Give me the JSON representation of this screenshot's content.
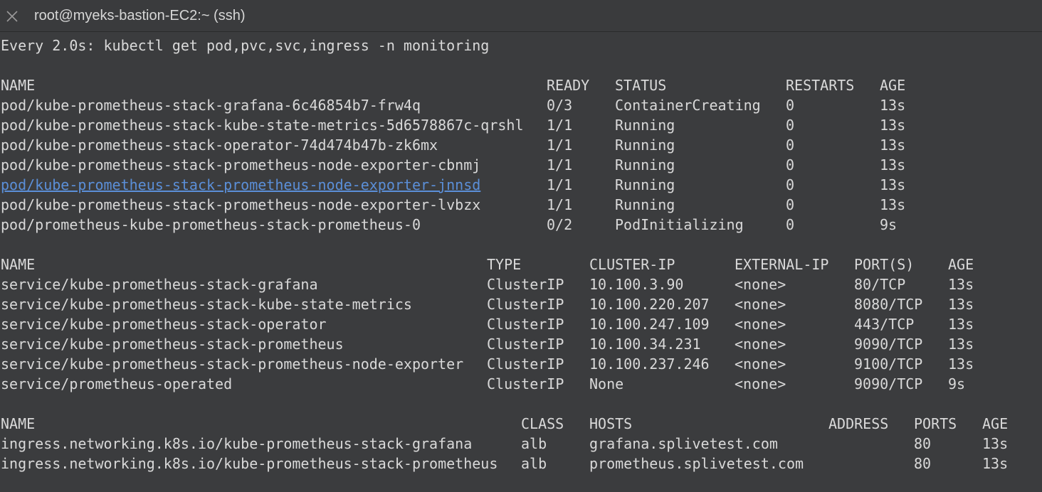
{
  "window": {
    "title": "root@myeks-bastion-EC2:~ (ssh)"
  },
  "watch_header": "Every 2.0s: kubectl get pod,pvc,svc,ingress -n monitoring",
  "pods": {
    "headers": [
      "NAME",
      "READY",
      "STATUS",
      "RESTARTS",
      "AGE"
    ],
    "rows": [
      [
        "pod/kube-prometheus-stack-grafana-6c46854b7-frw4q",
        "0/3",
        "ContainerCreating",
        "0",
        "13s"
      ],
      [
        "pod/kube-prometheus-stack-kube-state-metrics-5d6578867c-qrshl",
        "1/1",
        "Running",
        "0",
        "13s"
      ],
      [
        "pod/kube-prometheus-stack-operator-74d474b47b-zk6mx",
        "1/1",
        "Running",
        "0",
        "13s"
      ],
      [
        "pod/kube-prometheus-stack-prometheus-node-exporter-cbnmj",
        "1/1",
        "Running",
        "0",
        "13s"
      ],
      [
        "pod/kube-prometheus-stack-prometheus-node-exporter-jnnsd",
        "1/1",
        "Running",
        "0",
        "13s"
      ],
      [
        "pod/kube-prometheus-stack-prometheus-node-exporter-lvbzx",
        "1/1",
        "Running",
        "0",
        "13s"
      ],
      [
        "pod/prometheus-kube-prometheus-stack-prometheus-0",
        "0/2",
        "PodInitializing",
        "0",
        "9s"
      ]
    ]
  },
  "services": {
    "headers": [
      "NAME",
      "TYPE",
      "CLUSTER-IP",
      "EXTERNAL-IP",
      "PORT(S)",
      "AGE"
    ],
    "rows": [
      [
        "service/kube-prometheus-stack-grafana",
        "ClusterIP",
        "10.100.3.90",
        "<none>",
        "80/TCP",
        "13s"
      ],
      [
        "service/kube-prometheus-stack-kube-state-metrics",
        "ClusterIP",
        "10.100.220.207",
        "<none>",
        "8080/TCP",
        "13s"
      ],
      [
        "service/kube-prometheus-stack-operator",
        "ClusterIP",
        "10.100.247.109",
        "<none>",
        "443/TCP",
        "13s"
      ],
      [
        "service/kube-prometheus-stack-prometheus",
        "ClusterIP",
        "10.100.34.231",
        "<none>",
        "9090/TCP",
        "13s"
      ],
      [
        "service/kube-prometheus-stack-prometheus-node-exporter",
        "ClusterIP",
        "10.100.237.246",
        "<none>",
        "9100/TCP",
        "13s"
      ],
      [
        "service/prometheus-operated",
        "ClusterIP",
        "None",
        "<none>",
        "9090/TCP",
        "9s"
      ]
    ]
  },
  "ingresses": {
    "headers": [
      "NAME",
      "CLASS",
      "HOSTS",
      "ADDRESS",
      "PORTS",
      "AGE"
    ],
    "rows": [
      [
        "ingress.networking.k8s.io/kube-prometheus-stack-grafana",
        "alb",
        "grafana.splivetest.com",
        "",
        "80",
        "13s"
      ],
      [
        "ingress.networking.k8s.io/kube-prometheus-stack-prometheus",
        "alb",
        "prometheus.splivetest.com",
        "",
        "80",
        "13s"
      ]
    ]
  },
  "colors": {
    "background": "#3b3c3e",
    "text": "#d9d9d9",
    "link": "#5b8fd8"
  }
}
